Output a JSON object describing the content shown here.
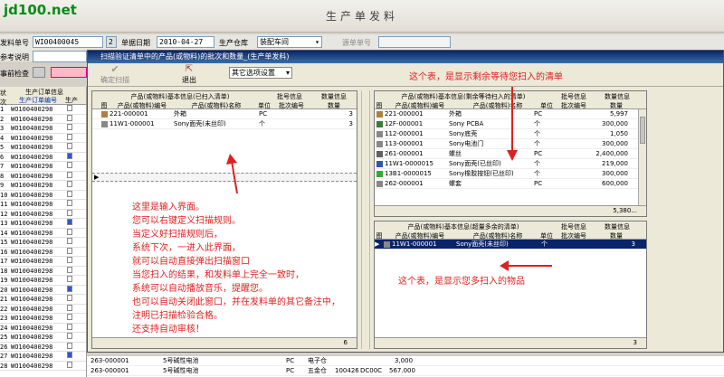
{
  "watermark": "jd100.net",
  "app": {
    "title": "生产单发料"
  },
  "form": {
    "bill_no_label": "发料单号",
    "bill_no": "WI00400045",
    "bill_no_seq": "2",
    "date_label": "单据日期",
    "date": "2010-04-27",
    "warehouse_label": "生产仓库",
    "warehouse": "装配车间",
    "source_label": "源单单号",
    "remark_label": "参考说明",
    "pre_label": "事前检查"
  },
  "bg_grid": {
    "col_idx": "状次",
    "col_order": "生产订单信息",
    "col_order_no": "生产订单编号",
    "col_pro": "生产",
    "rows": [
      "WO100400298",
      "WO100400298",
      "WO100400298",
      "WO100400298",
      "WO100400298",
      "WO100400298",
      "WO100400298",
      "WO100400298",
      "WO100400298",
      "WO100400298",
      "WO100400298",
      "WO100400298",
      "WO100400298",
      "WO100400298",
      "WO100400298",
      "WO100400298",
      "WO100400298",
      "WO100400298",
      "WO100400298",
      "WO100400298",
      "WO100400298",
      "WO100400298",
      "WO100400298",
      "WO100400298",
      "WO100400298",
      "WO100400298",
      "WO100400298",
      "WO100400298"
    ],
    "bottom_rows": [
      {
        "code": "263-000001",
        "name": "5号碱性电池",
        "unit": "PC",
        "wh": "电子仓",
        "qty": "3,000"
      },
      {
        "code": "263-000001",
        "name": "5号碱性电池",
        "unit": "PC",
        "wh": "五金仓",
        "batch": "100426",
        "loc": "DC00C",
        "qty": "567.000"
      }
    ]
  },
  "dialog": {
    "title": "扫描验证清单中的产品(或物料)的批次和数量_(生产单发料)",
    "confirm_label": "确定扫描",
    "exit_label": "退出",
    "options_label": "其它选项设置",
    "left": {
      "group1": "产品(或物料)基本信息(已扫入清单)",
      "group2": "批号信息",
      "group3": "数量信息",
      "col_pic": "图",
      "col_code": "产品(或物料)编号",
      "col_name": "产品(或物料)名称",
      "col_unit": "单位",
      "col_batch": "批次编号",
      "col_qty": "数量",
      "rows": [
        {
          "code": "221-000001",
          "name": "外箱",
          "unit": "PC",
          "qty": "3"
        },
        {
          "code": "11W1-000001",
          "name": "Sony面壳(未丝印)",
          "unit": "个",
          "qty": "3"
        }
      ],
      "total": "6"
    },
    "right_top": {
      "group1": "产品(或物料)基本信息(剩余等待扫入的清单)",
      "group2": "批号信息",
      "group3": "数量信息",
      "col_pic": "图",
      "col_code": "产品(或物料)编号",
      "col_name": "产品(或物料)名称",
      "col_unit": "单位",
      "col_batch": "批次编号",
      "col_qty": "数量",
      "rows": [
        {
          "code": "221-000001",
          "name": "外箱",
          "unit": "PC",
          "qty": "5,997"
        },
        {
          "code": "12F-000001",
          "name": "Sony PCBA",
          "unit": "个",
          "qty": "300,000"
        },
        {
          "code": "112-000001",
          "name": "Sony底壳",
          "unit": "个",
          "qty": "1,050"
        },
        {
          "code": "113-000001",
          "name": "Sony电池门",
          "unit": "个",
          "qty": "300,000"
        },
        {
          "code": "261-000001",
          "name": "螺丝",
          "unit": "PC",
          "qty": "2,400,000"
        },
        {
          "code": "11W1-0000015",
          "name": "Sony面壳(已丝印)",
          "unit": "个",
          "qty": "219,000"
        },
        {
          "code": "13B1-0000015",
          "name": "Sony橡胶按钮(已丝印)",
          "unit": "个",
          "qty": "300,000"
        },
        {
          "code": "262-000001",
          "name": "螺套",
          "unit": "PC",
          "qty": "600,000"
        }
      ],
      "total": "5,380..."
    },
    "right_bottom": {
      "group1": "产品(或物料)基本信息(超量多余的清单)",
      "group2": "批号信息",
      "group3": "数量信息",
      "col_pic": "图",
      "col_code": "产品(或物料)编号",
      "col_name": "产品(或物料)名称",
      "col_unit": "单位",
      "col_batch": "批次编号",
      "col_qty": "数量",
      "rows": [
        {
          "code": "11W1-000001",
          "name": "Sony面壳(未丝印)",
          "unit": "个",
          "qty": "3"
        }
      ],
      "total": "3"
    }
  },
  "annotations": {
    "top_right": "这个表，是显示剩余等待您扫入的清单",
    "bottom_right": "这个表，是显示您多扫入的物品",
    "left_lines": [
      "这里是输入界面。",
      "您可以右键定义扫描规则。",
      "当定义好扫描规则后，",
      "系统下次，一进入此界面，",
      "就可以自动直接弹出扫描窗口",
      "当您扫入的结果，和发料单上完全一致时，",
      "系统可以自动播放音乐，提醒您。",
      "也可以自动关闭此窗口，并在发料单的其它备注中，",
      "注明已扫描检验合格。",
      "还支持自动审核！"
    ]
  }
}
